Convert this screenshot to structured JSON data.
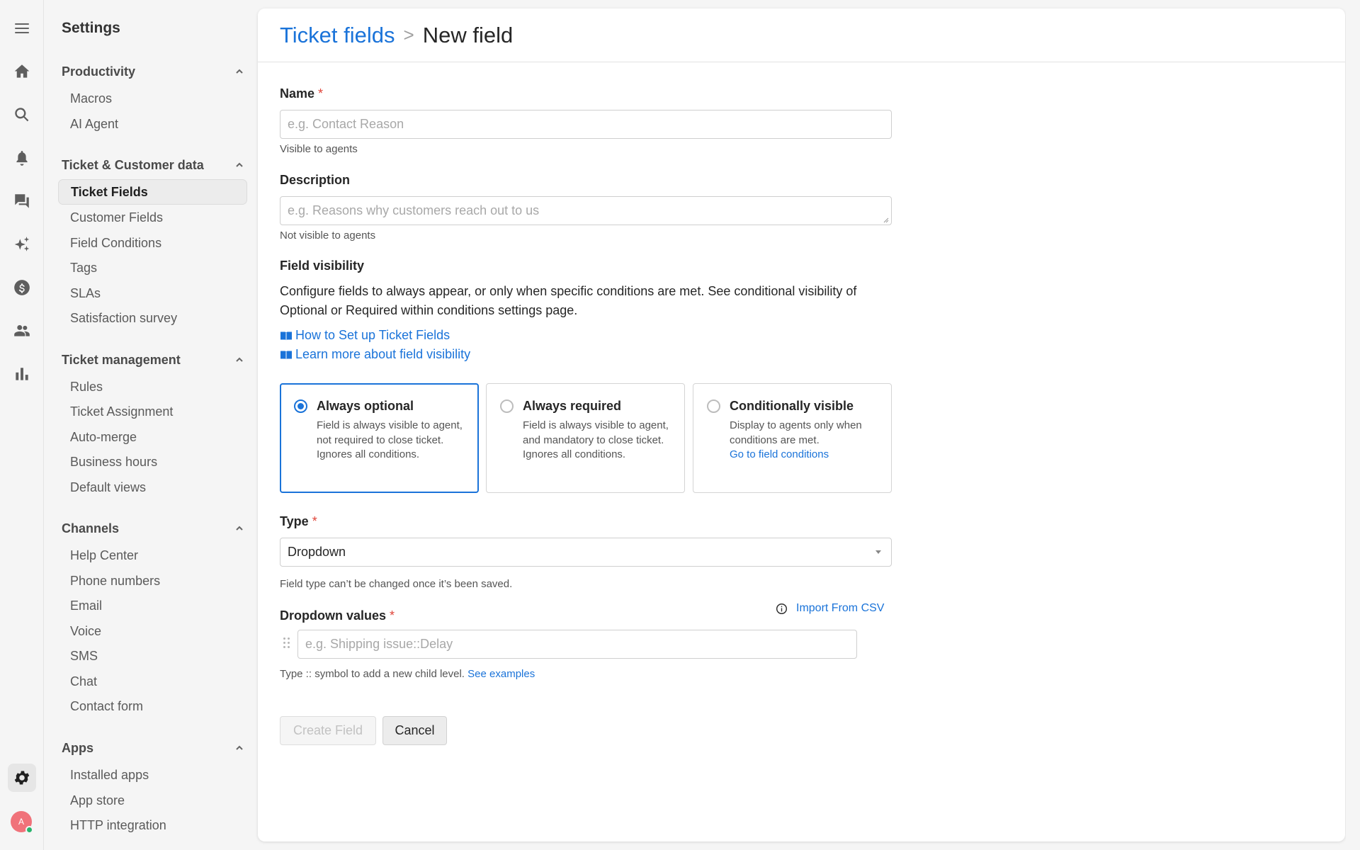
{
  "rail": {
    "items": [
      "menu",
      "home",
      "search",
      "notifications",
      "conversations",
      "ai",
      "billing",
      "customers",
      "reports"
    ],
    "settings": "settings",
    "avatar_initial": "A"
  },
  "sidebar": {
    "title": "Settings",
    "sections": [
      {
        "label": "Productivity",
        "items": [
          "Macros",
          "AI Agent"
        ]
      },
      {
        "label": "Ticket & Customer data",
        "items": [
          "Ticket Fields",
          "Customer Fields",
          "Field Conditions",
          "Tags",
          "SLAs",
          "Satisfaction survey"
        ]
      },
      {
        "label": "Ticket management",
        "items": [
          "Rules",
          "Ticket Assignment",
          "Auto-merge",
          "Business hours",
          "Default views"
        ]
      },
      {
        "label": "Channels",
        "items": [
          "Help Center",
          "Phone numbers",
          "Email",
          "Voice",
          "SMS",
          "Chat",
          "Contact form"
        ]
      },
      {
        "label": "Apps",
        "items": [
          "Installed apps",
          "App store",
          "HTTP integration"
        ]
      }
    ],
    "active_item": "Ticket Fields"
  },
  "header": {
    "breadcrumb_link": "Ticket fields",
    "separator": ">",
    "current": "New field"
  },
  "form": {
    "name": {
      "label": "Name",
      "required_mark": "*",
      "placeholder": "e.g. Contact Reason",
      "value": "",
      "help": "Visible to agents"
    },
    "description": {
      "label": "Description",
      "placeholder": "e.g. Reasons why customers reach out to us",
      "value": "",
      "help": "Not visible to agents"
    },
    "visibility": {
      "label": "Field visibility",
      "text": "Configure fields to always appear, or only when specific conditions are met. See conditional visibility of Optional or Required within conditions settings page.",
      "link1": "How to Set up Ticket Fields",
      "link2": "Learn more about field visibility",
      "options": [
        {
          "title": "Always optional",
          "desc": "Field is always visible to agent, not required to close ticket. Ignores all conditions.",
          "selected": true
        },
        {
          "title": "Always required",
          "desc": "Field is always visible to agent, and mandatory to close ticket. Ignores all conditions.",
          "selected": false
        },
        {
          "title": "Conditionally visible",
          "desc": "Display to agents only when conditions are met.",
          "link": "Go to field conditions",
          "selected": false
        }
      ]
    },
    "type": {
      "label": "Type",
      "required_mark": "*",
      "value": "Dropdown",
      "help": "Field type can’t be changed once it’s been saved."
    },
    "dropdown_values": {
      "label": "Dropdown values",
      "required_mark": "*",
      "import_label": "Import From CSV",
      "placeholder": "e.g. Shipping issue::Delay",
      "help": "Type :: symbol to add a new child level.",
      "help_link": "See examples"
    },
    "buttons": {
      "create": "Create Field",
      "cancel": "Cancel"
    }
  },
  "colors": {
    "accent": "#1a73d9",
    "required": "#e0453a",
    "avatar": "#f0727a",
    "online": "#27b36b"
  }
}
